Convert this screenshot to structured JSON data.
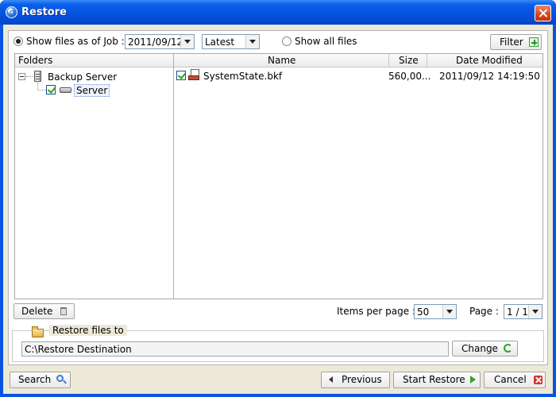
{
  "window": {
    "title": "Restore"
  },
  "filter_bar": {
    "show_files_as_of_job_label": "Show files as of Job :",
    "job_date": "2011/09/12",
    "job_version": "Latest",
    "show_all_files_label": "Show all files",
    "filter_label": "Filter",
    "mode_selected": "show_files_as_of_job"
  },
  "folders_pane": {
    "header": "Folders",
    "tree": [
      {
        "label": "Backup Server",
        "icon": "server-icon"
      },
      {
        "label": "Server",
        "icon": "drive-icon",
        "checked": true,
        "selected": true
      }
    ]
  },
  "files_pane": {
    "columns": [
      "Name",
      "Size",
      "Date Modified"
    ],
    "rows": [
      {
        "name": "SystemState.bkf",
        "size": "560,00...",
        "date_modified": "2011/09/12 14:19:50",
        "checked": true
      }
    ]
  },
  "list_footer": {
    "delete_label": "Delete",
    "items_per_page_label": "Items per page :",
    "items_per_page": "50",
    "page_label": "Page :",
    "page_value": "1 / 1"
  },
  "restore_to": {
    "legend": "Restore files to",
    "path": "C:\\Restore Destination",
    "change_label": "Change"
  },
  "bottom_bar": {
    "search_label": "Search",
    "previous_label": "Previous",
    "start_restore_label": "Start Restore",
    "cancel_label": "Cancel"
  },
  "colors": {
    "title_bar": "#0a54e2",
    "client_background": "#ece9d8",
    "check_green": "#21a121",
    "close_red": "#d9461c"
  }
}
